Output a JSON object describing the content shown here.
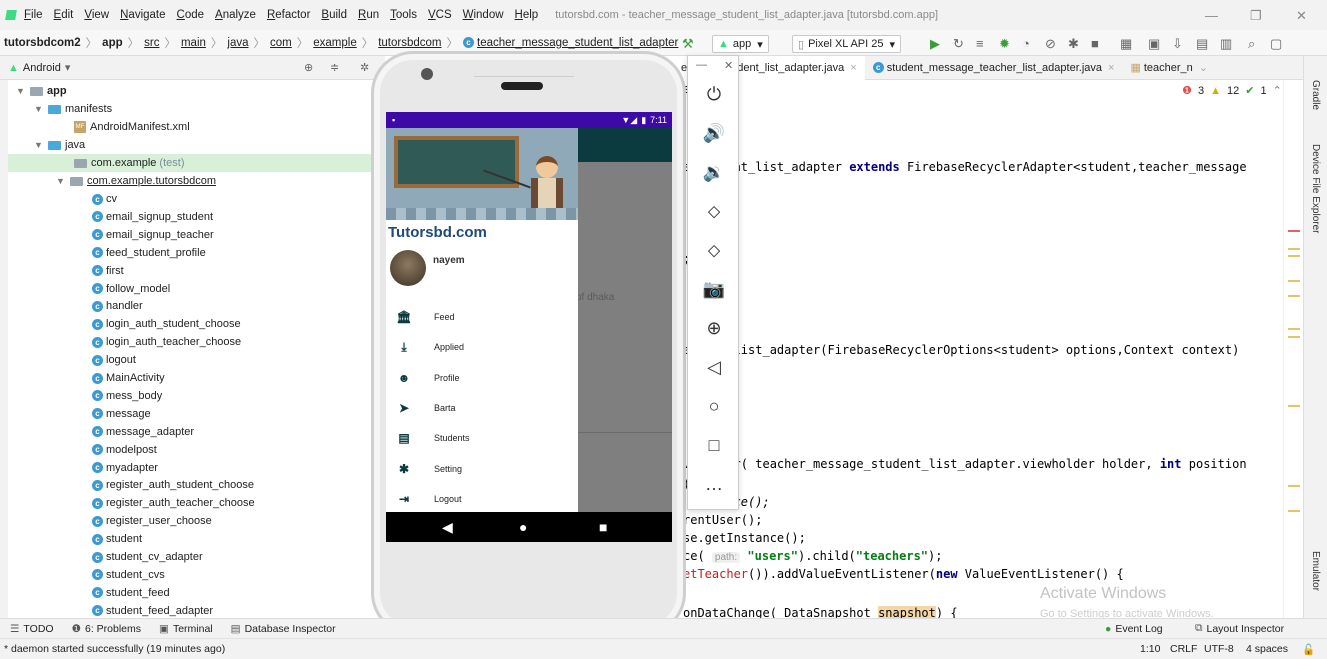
{
  "menu": {
    "items": [
      "File",
      "Edit",
      "View",
      "Navigate",
      "Code",
      "Analyze",
      "Refactor",
      "Build",
      "Run",
      "Tools",
      "VCS",
      "Window",
      "Help"
    ],
    "window_title": "tutorsbd.com - teacher_message_student_list_adapter.java [tutorsbd.com.app]",
    "minimize": "—",
    "restore": "❐",
    "close": "✕"
  },
  "breadcrumbs": [
    "tutorsbdcom2",
    "app",
    "src",
    "main",
    "java",
    "com",
    "example",
    "tutorsbdcom",
    "teacher_message_student_list_adapter"
  ],
  "toolbar": {
    "run_config": "app",
    "device": "Pixel XL API 25"
  },
  "project_panel": {
    "view_label": "Android",
    "tree": [
      {
        "label": "app",
        "kind": "module"
      },
      {
        "label": "manifests",
        "kind": "folder"
      },
      {
        "label": "AndroidManifest.xml",
        "kind": "manifest"
      },
      {
        "label": "java",
        "kind": "folder"
      },
      {
        "label": "com.example",
        "muted": "(test)",
        "kind": "package"
      },
      {
        "label": "com.example.tutorsbdcom",
        "kind": "package"
      },
      {
        "label": "cv"
      },
      {
        "label": "email_signup_student"
      },
      {
        "label": "email_signup_teacher"
      },
      {
        "label": "feed_student_profile"
      },
      {
        "label": "first"
      },
      {
        "label": "follow_model"
      },
      {
        "label": "handler"
      },
      {
        "label": "login_auth_student_choose"
      },
      {
        "label": "login_auth_teacher_choose"
      },
      {
        "label": "logout"
      },
      {
        "label": "MainActivity"
      },
      {
        "label": "mess_body"
      },
      {
        "label": "message"
      },
      {
        "label": "message_adapter"
      },
      {
        "label": "modelpost"
      },
      {
        "label": "myadapter"
      },
      {
        "label": "register_auth_student_choose"
      },
      {
        "label": "register_auth_teacher_choose"
      },
      {
        "label": "register_user_choose"
      },
      {
        "label": "student"
      },
      {
        "label": "student_cv_adapter"
      },
      {
        "label": "student_cvs"
      },
      {
        "label": "student_feed"
      },
      {
        "label": "student_feed_adapter"
      }
    ]
  },
  "editor": {
    "tabs": [
      {
        "label": "essage_student_list_adapter.java",
        "active": true
      },
      {
        "label": "student_message_teacher_list_adapter.java",
        "active": false
      },
      {
        "label": "teacher_n",
        "active": false
      }
    ],
    "inspections": {
      "errors": "3",
      "warnings": "12",
      "weak": "1"
    },
    "lines": {
      "l0": "s",
      "l1a": "a",
      "l1b": "ent_list_adapter ",
      "l1kw": "extends",
      "l1c": " FirebaseRecyclerAdapter<student,teacher_message",
      "l2": ";",
      "l3": "e     _list_adapter(FirebaseRecyclerOptions<student> options,Context context)",
      "l4a": "V     er( teacher_message_student_list_adapter.viewholder holder, ",
      "l4kw": "int",
      "l4b": " position",
      "l5": "(",
      "l6": "      nce();",
      "l7": "rentUser();",
      "l8": "se.getInstance();",
      "l9a": "ce( ",
      "l9hint": "path:",
      "l9str": "\"users\"",
      "l9b": ").child(",
      "l9str2": "\"teachers\"",
      "l9c": ");",
      "l10a": "etTeacher",
      "l10b": "()).addValueEventListener(",
      "l10kw": "new",
      "l10c": " ValueEventListener() {",
      "l11a": "onDataChange( DataSnapshot ",
      "l11hl": "snapshot",
      "l11b": ") {"
    }
  },
  "phone": {
    "status_time": "7:11",
    "stray_text": "of dhaka",
    "brand": "Tutorsbd.com",
    "user_name": "nayem",
    "drawer_items": [
      {
        "label": "Feed",
        "icon": "🏛"
      },
      {
        "label": "Applied",
        "icon": "⤓"
      },
      {
        "label": "Profile",
        "icon": "☻"
      },
      {
        "label": "Barta",
        "icon": "➤"
      },
      {
        "label": "Students",
        "icon": "▤"
      },
      {
        "label": "Setting",
        "icon": "✱"
      },
      {
        "label": "Logout",
        "icon": "⇥"
      }
    ]
  },
  "emulator_controls": {
    "close": "✕",
    "minimize": "—",
    "buttons": [
      "power-icon",
      "volume-up-icon",
      "volume-down-icon",
      "rotate-left-icon",
      "rotate-right-icon",
      "camera-icon",
      "zoom-icon",
      "back-icon",
      "home-icon",
      "overview-icon",
      "more-icon"
    ],
    "glyphs": [
      "⏻",
      "🔊",
      "🔉",
      "⬦",
      "⬦",
      "📷",
      "⊕",
      "◁",
      "○",
      "□",
      "…"
    ]
  },
  "right_strip": {
    "gradle": "Gradle",
    "device_explorer": "Device File Explorer",
    "emulator": "Emulator"
  },
  "bottom_tools": [
    {
      "label": "TODO",
      "icon": "☰"
    },
    {
      "label": "6: Problems",
      "icon": "❶"
    },
    {
      "label": "Terminal",
      "icon": "▣"
    },
    {
      "label": "Database Inspector",
      "icon": "▤"
    }
  ],
  "bottom_right_tools": {
    "event_log": "Event Log",
    "layout_inspector": "Layout Inspector"
  },
  "status": {
    "message": "* daemon started successfully (19 minutes ago)",
    "position": "1:10",
    "line_sep": "CRLF",
    "encoding": "UTF-8",
    "indent": "4 spaces"
  },
  "watermark": {
    "line1": "Activate Windows",
    "line2": "Go to Settings to activate Windows."
  },
  "colors": {
    "status_bar": "#3d0aa8",
    "app_bar": "#0b3b3f",
    "brand_text": "#1f4a77"
  }
}
